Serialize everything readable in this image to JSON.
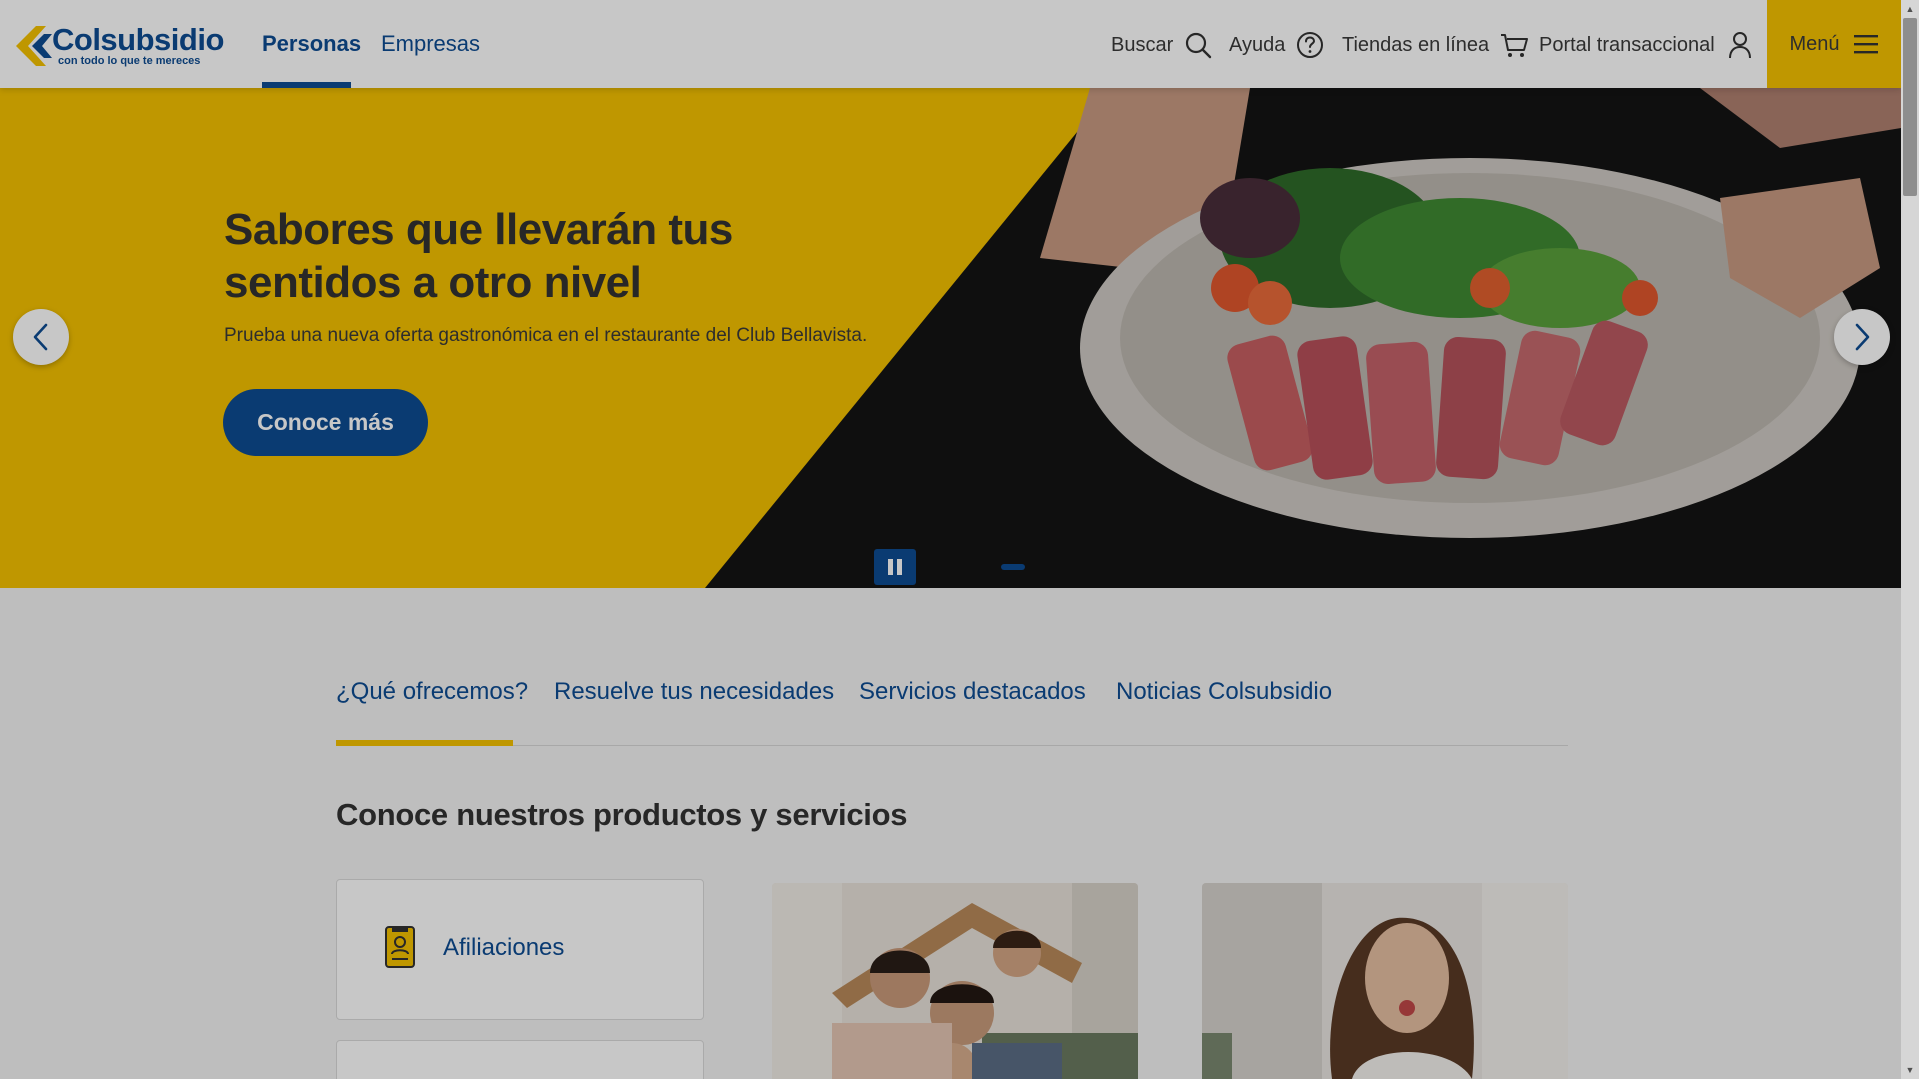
{
  "brand": {
    "name": "Colsubsidio",
    "tagline": "con todo lo que te mereces"
  },
  "nav": {
    "tabs": [
      {
        "label": "Personas"
      },
      {
        "label": "Empresas"
      }
    ],
    "tools": {
      "search": "Buscar",
      "help": "Ayuda",
      "shops": "Tiendas en línea",
      "portal": "Portal transaccional"
    },
    "menu": "Menú"
  },
  "hero": {
    "title": "Sabores que llevarán tus sentidos a otro nivel",
    "description": "Prueba una nueva oferta gastronómica en el restaurante del Club Bellavista.",
    "cta": "Conoce más"
  },
  "section_tabs": [
    {
      "label": "¿Qué ofrecemos?"
    },
    {
      "label": "Resuelve tus necesidades"
    },
    {
      "label": "Servicios destacados"
    },
    {
      "label": "Noticias Colsubsidio"
    }
  ],
  "section_title": "Conoce nuestros productos y servicios",
  "cards": [
    {
      "label": "Afiliaciones"
    }
  ],
  "colors": {
    "brand_blue": "#0e4c92",
    "brand_yellow": "#f5c200"
  }
}
